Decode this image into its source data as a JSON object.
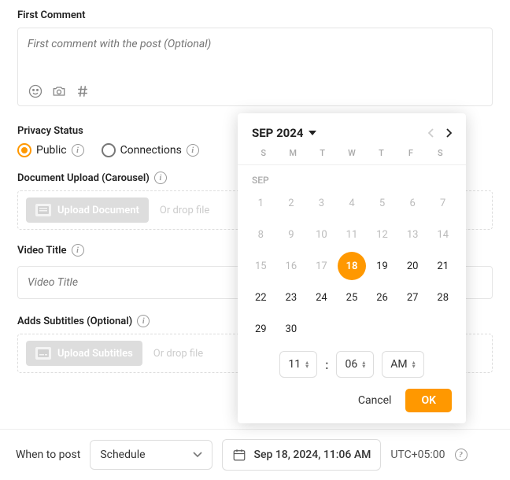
{
  "first_comment": {
    "label": "First Comment",
    "placeholder": "First comment with the post (Optional)"
  },
  "privacy": {
    "label": "Privacy Status",
    "options": {
      "public": "Public",
      "connections": "Connections"
    },
    "selected": "public"
  },
  "document_upload": {
    "label": "Document Upload (Carousel)",
    "button": "Upload Document",
    "drop_text": "Or drop file"
  },
  "video_title": {
    "label": "Video Title",
    "placeholder": "Video Title"
  },
  "subtitles": {
    "label": "Adds Subtitles (Optional)",
    "button": "Upload Subtitles",
    "drop_text": "Or drop file"
  },
  "bottom_bar": {
    "when_label": "When to post",
    "schedule_value": "Schedule",
    "date_display": "Sep 18, 2024, 11:06 AM",
    "timezone": "UTC+05:00"
  },
  "calendar": {
    "month_year": "SEP 2024",
    "dows": [
      "S",
      "M",
      "T",
      "W",
      "T",
      "F",
      "S"
    ],
    "month_short": "SEP",
    "days": [
      {
        "n": 1,
        "state": "past"
      },
      {
        "n": 2,
        "state": "past"
      },
      {
        "n": 3,
        "state": "past"
      },
      {
        "n": 4,
        "state": "past"
      },
      {
        "n": 5,
        "state": "past"
      },
      {
        "n": 6,
        "state": "past"
      },
      {
        "n": 7,
        "state": "past"
      },
      {
        "n": 8,
        "state": "past"
      },
      {
        "n": 9,
        "state": "past"
      },
      {
        "n": 10,
        "state": "past"
      },
      {
        "n": 11,
        "state": "past"
      },
      {
        "n": 12,
        "state": "past"
      },
      {
        "n": 13,
        "state": "past"
      },
      {
        "n": 14,
        "state": "past"
      },
      {
        "n": 15,
        "state": "past"
      },
      {
        "n": 16,
        "state": "past"
      },
      {
        "n": 17,
        "state": "past"
      },
      {
        "n": 18,
        "state": "selected"
      },
      {
        "n": 19,
        "state": "future"
      },
      {
        "n": 20,
        "state": "future"
      },
      {
        "n": 21,
        "state": "future"
      },
      {
        "n": 22,
        "state": "future"
      },
      {
        "n": 23,
        "state": "future"
      },
      {
        "n": 24,
        "state": "future"
      },
      {
        "n": 25,
        "state": "future"
      },
      {
        "n": 26,
        "state": "future"
      },
      {
        "n": 27,
        "state": "future"
      },
      {
        "n": 28,
        "state": "future"
      },
      {
        "n": 29,
        "state": "future"
      },
      {
        "n": 30,
        "state": "future"
      }
    ],
    "time": {
      "hour": "11",
      "minute": "06",
      "meridiem": "AM"
    },
    "cancel": "Cancel",
    "ok": "OK"
  }
}
